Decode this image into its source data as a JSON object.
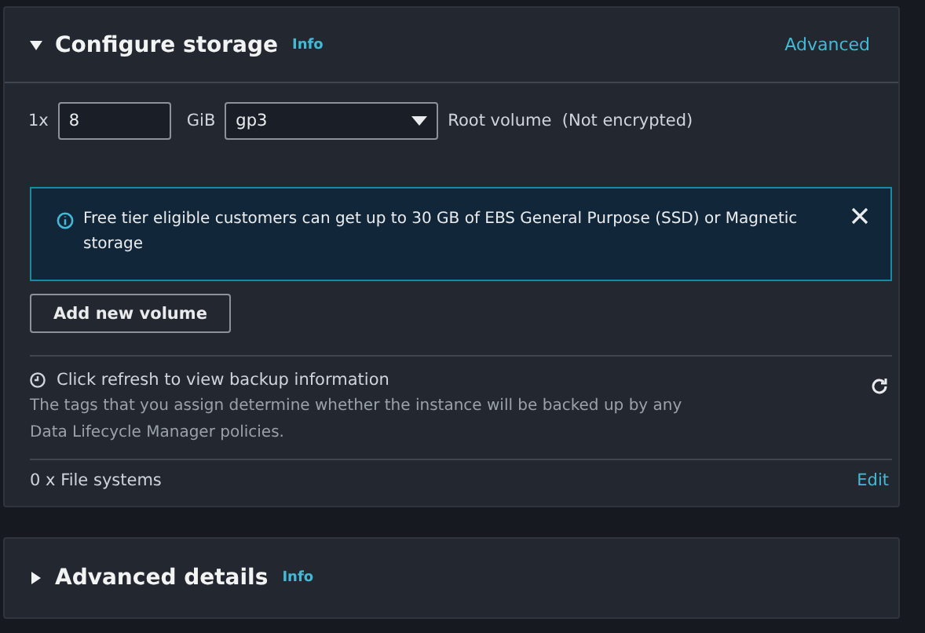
{
  "sections": [
    {
      "title": "Configure storage",
      "info": "Info",
      "expanded": true,
      "action": "Advanced",
      "volume": {
        "count": "1x",
        "size": "8",
        "unit": "GiB",
        "type": "gp3",
        "description": "Root volume  (Not encrypted)"
      },
      "alert": {
        "text": "Free tier eligible customers can get up to 30 GB of EBS General Purpose (SSD) or Magnetic storage"
      },
      "add_button": "Add new volume",
      "backup": {
        "title": "Click refresh to view backup information",
        "description": "The tags that you assign determine whether the instance will be backed up by any Data Lifecycle Manager policies."
      },
      "file_systems": {
        "label": "0 x File systems",
        "action": "Edit"
      }
    },
    {
      "title": "Advanced details",
      "info": "Info",
      "expanded": false
    }
  ]
}
